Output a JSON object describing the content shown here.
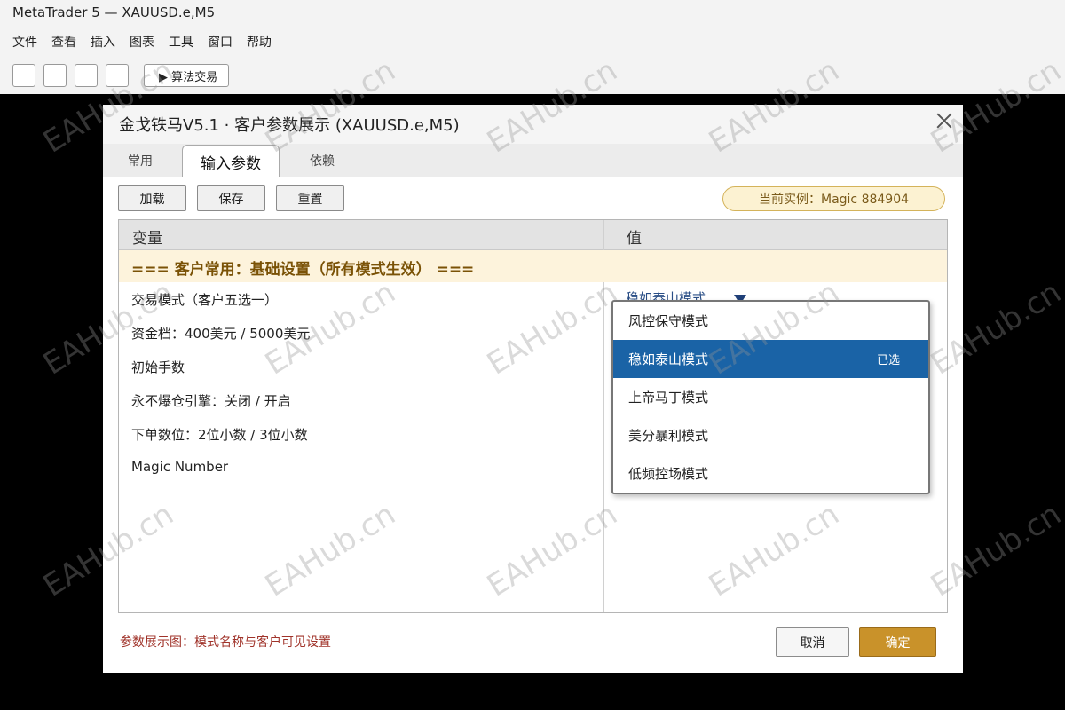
{
  "app": {
    "title": "MetaTrader 5 — XAUUSD.e,M5"
  },
  "menu": [
    "文件",
    "查看",
    "插入",
    "图表",
    "工具",
    "窗口",
    "帮助"
  ],
  "toolbar": {
    "algo_label": "▶ 算法交易"
  },
  "dialog": {
    "title": "金戈铁马V5.1 ·  客户参数展示 (XAUUSD.e,M5)",
    "tabs": [
      "常用",
      "输入参数",
      "依赖"
    ],
    "active_tab": "输入参数",
    "buttons": {
      "load": "加载",
      "save": "保存",
      "reset": "重置"
    },
    "magic_badge": "当前实例：Magic 884904",
    "grid": {
      "col_variable": "变量",
      "col_value": "值",
      "section": "=== 客户常用：基础设置（所有模式生效） ===",
      "rows": [
        "交易模式（客户五选一）",
        "资金档：400美元 / 5000美元",
        "初始手数",
        "永不爆仓引擎：关闭 / 开启",
        "下单数位：2位小数 / 3位小数",
        "Magic Number"
      ],
      "current_value": "稳如泰山模式"
    },
    "dropdown": {
      "options": [
        "风控保守模式",
        "稳如泰山模式",
        "上帝马丁模式",
        "美分暴利模式",
        "低频控场模式"
      ],
      "selected_index": 1,
      "selected_tag": "已选"
    },
    "footer_note": "参数展示图：模式名称与客户可见设置",
    "cancel": "取消",
    "ok": "确定"
  },
  "watermark": "EAHub.cn"
}
